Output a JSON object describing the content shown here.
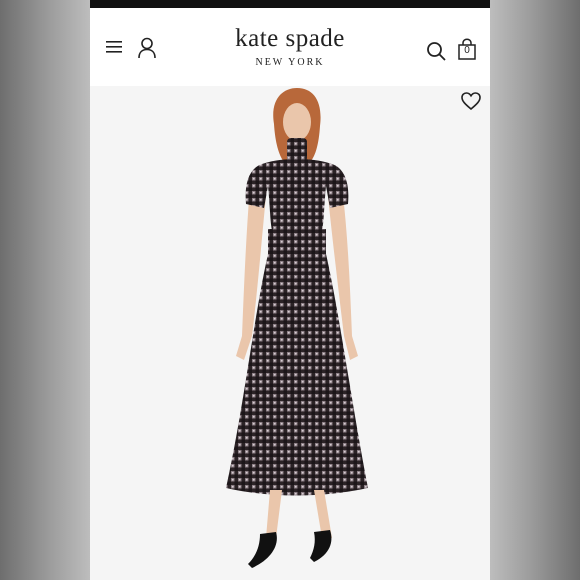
{
  "header": {
    "brand_name": "kate spade",
    "brand_sub": "NEW YORK",
    "bag_count": "0"
  },
  "icons": {
    "menu": "hamburger-menu-icon",
    "account": "person-icon",
    "search": "magnifier-icon",
    "bag": "shopping-bag-icon",
    "wishlist": "heart-outline-icon"
  },
  "product": {
    "image": "model wearing a gingham high-neck midi dress with black bow heels"
  },
  "colors": {
    "header_bg": "#ffffff",
    "text": "#222222",
    "dress": "#2b2326",
    "skin": "#e8c3a8",
    "hair": "#b8683a"
  }
}
